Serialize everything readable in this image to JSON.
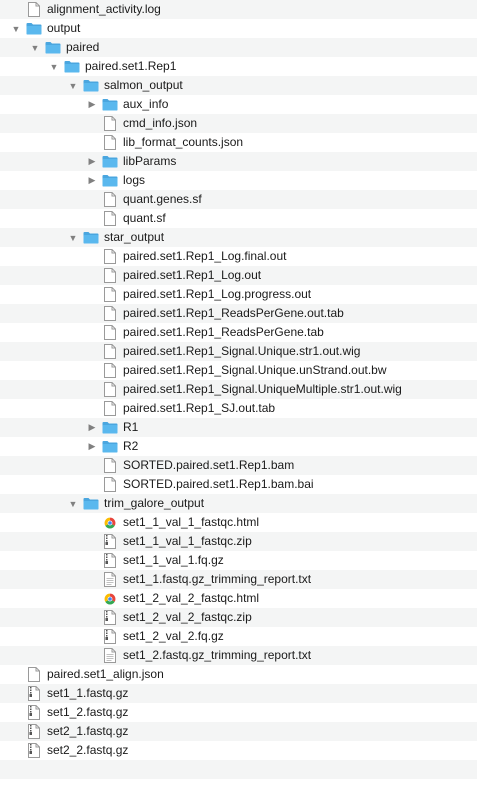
{
  "tree": [
    {
      "name": "alignment_activity.log",
      "icon": "document-icon",
      "depth": 0,
      "kind": "file"
    },
    {
      "name": "output",
      "icon": "folder-icon",
      "depth": 0,
      "kind": "folder",
      "expanded": true
    },
    {
      "name": "paired",
      "icon": "folder-icon",
      "depth": 1,
      "kind": "folder",
      "expanded": true
    },
    {
      "name": "paired.set1.Rep1",
      "icon": "folder-icon",
      "depth": 2,
      "kind": "folder",
      "expanded": true
    },
    {
      "name": "salmon_output",
      "icon": "folder-icon",
      "depth": 3,
      "kind": "folder",
      "expanded": true
    },
    {
      "name": "aux_info",
      "icon": "folder-icon",
      "depth": 4,
      "kind": "folder",
      "expanded": false
    },
    {
      "name": "cmd_info.json",
      "icon": "document-icon",
      "depth": 4,
      "kind": "file"
    },
    {
      "name": "lib_format_counts.json",
      "icon": "document-icon",
      "depth": 4,
      "kind": "file"
    },
    {
      "name": "libParams",
      "icon": "folder-icon",
      "depth": 4,
      "kind": "folder",
      "expanded": false
    },
    {
      "name": "logs",
      "icon": "folder-icon",
      "depth": 4,
      "kind": "folder",
      "expanded": false
    },
    {
      "name": "quant.genes.sf",
      "icon": "document-icon",
      "depth": 4,
      "kind": "file"
    },
    {
      "name": "quant.sf",
      "icon": "document-icon",
      "depth": 4,
      "kind": "file"
    },
    {
      "name": "star_output",
      "icon": "folder-icon",
      "depth": 3,
      "kind": "folder",
      "expanded": true
    },
    {
      "name": "paired.set1.Rep1_Log.final.out",
      "icon": "document-icon",
      "depth": 4,
      "kind": "file"
    },
    {
      "name": "paired.set1.Rep1_Log.out",
      "icon": "document-icon",
      "depth": 4,
      "kind": "file"
    },
    {
      "name": "paired.set1.Rep1_Log.progress.out",
      "icon": "document-icon",
      "depth": 4,
      "kind": "file"
    },
    {
      "name": "paired.set1.Rep1_ReadsPerGene.out.tab",
      "icon": "document-icon",
      "depth": 4,
      "kind": "file"
    },
    {
      "name": "paired.set1.Rep1_ReadsPerGene.tab",
      "icon": "document-icon",
      "depth": 4,
      "kind": "file"
    },
    {
      "name": "paired.set1.Rep1_Signal.Unique.str1.out.wig",
      "icon": "document-icon",
      "depth": 4,
      "kind": "file"
    },
    {
      "name": "paired.set1.Rep1_Signal.Unique.unStrand.out.bw",
      "icon": "document-icon",
      "depth": 4,
      "kind": "file"
    },
    {
      "name": "paired.set1.Rep1_Signal.UniqueMultiple.str1.out.wig",
      "icon": "document-icon",
      "depth": 4,
      "kind": "file"
    },
    {
      "name": "paired.set1.Rep1_SJ.out.tab",
      "icon": "document-icon",
      "depth": 4,
      "kind": "file"
    },
    {
      "name": "R1",
      "icon": "folder-icon",
      "depth": 4,
      "kind": "folder",
      "expanded": false
    },
    {
      "name": "R2",
      "icon": "folder-icon",
      "depth": 4,
      "kind": "folder",
      "expanded": false
    },
    {
      "name": "SORTED.paired.set1.Rep1.bam",
      "icon": "document-icon",
      "depth": 4,
      "kind": "file"
    },
    {
      "name": "SORTED.paired.set1.Rep1.bam.bai",
      "icon": "document-icon",
      "depth": 4,
      "kind": "file"
    },
    {
      "name": "trim_galore_output",
      "icon": "folder-icon",
      "depth": 3,
      "kind": "folder",
      "expanded": true
    },
    {
      "name": "set1_1_val_1_fastqc.html",
      "icon": "html-icon",
      "depth": 4,
      "kind": "file"
    },
    {
      "name": "set1_1_val_1_fastqc.zip",
      "icon": "archive-icon",
      "depth": 4,
      "kind": "file"
    },
    {
      "name": "set1_1_val_1.fq.gz",
      "icon": "archive-icon",
      "depth": 4,
      "kind": "file"
    },
    {
      "name": "set1_1.fastq.gz_trimming_report.txt",
      "icon": "text-document-icon",
      "depth": 4,
      "kind": "file"
    },
    {
      "name": "set1_2_val_2_fastqc.html",
      "icon": "html-icon",
      "depth": 4,
      "kind": "file"
    },
    {
      "name": "set1_2_val_2_fastqc.zip",
      "icon": "archive-icon",
      "depth": 4,
      "kind": "file"
    },
    {
      "name": "set1_2_val_2.fq.gz",
      "icon": "archive-icon",
      "depth": 4,
      "kind": "file"
    },
    {
      "name": "set1_2.fastq.gz_trimming_report.txt",
      "icon": "text-document-icon",
      "depth": 4,
      "kind": "file"
    },
    {
      "name": "paired.set1_align.json",
      "icon": "document-icon",
      "depth": 0,
      "kind": "file"
    },
    {
      "name": "set1_1.fastq.gz",
      "icon": "archive-icon",
      "depth": 0,
      "kind": "file"
    },
    {
      "name": "set1_2.fastq.gz",
      "icon": "archive-icon",
      "depth": 0,
      "kind": "file"
    },
    {
      "name": "set2_1.fastq.gz",
      "icon": "archive-icon",
      "depth": 0,
      "kind": "file"
    },
    {
      "name": "set2_2.fastq.gz",
      "icon": "archive-icon",
      "depth": 0,
      "kind": "file"
    }
  ],
  "colors": {
    "folder": "#5ab8ee",
    "folder_tab": "#4aa6df",
    "stripe": "#f4f5f5",
    "disclosure": "#808080",
    "text": "#1a1a1a"
  }
}
